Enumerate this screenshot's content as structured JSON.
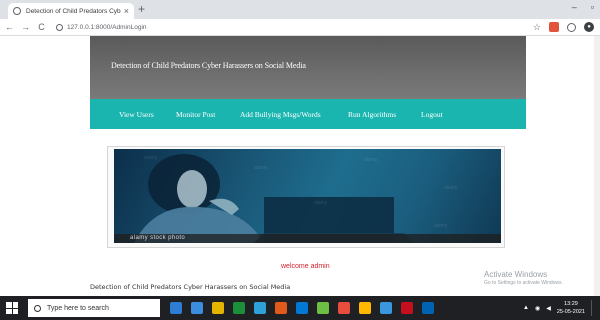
{
  "browser": {
    "tab_title": "Detection of Child Predators Cyb",
    "tab_close": "×",
    "new_tab": "+",
    "minimize": "–",
    "restore": "▫",
    "url": "127.0.0.1:8000/AdminLogin"
  },
  "site": {
    "title": "Detection of Child Predators Cyber Harassers on Social Media",
    "nav": [
      {
        "label": "View Users"
      },
      {
        "label": "Monitor Post"
      },
      {
        "label": "Add Bullying Msgs/Words"
      },
      {
        "label": "Run Algorithms"
      },
      {
        "label": "Logout"
      }
    ],
    "image_watermark": "alamy stock photo",
    "welcome": "welcome admin",
    "footer": "Detection of Child Predators Cyber Harassers on Social Media"
  },
  "windows_overlay": {
    "line1": "Activate Windows",
    "line2": "Go to Settings to activate Windows."
  },
  "taskbar": {
    "search_placeholder": "Type here to search",
    "app_colors": [
      "#2d7dd2",
      "#3c8dde",
      "#e3b400",
      "#1b8f3a",
      "#2fa0d8",
      "#e05a1c",
      "#0078d4",
      "#6cbe45",
      "#e84c3d",
      "#ffb900",
      "#3a96dd",
      "#c50f1f",
      "#0063b1"
    ],
    "time": "13:29",
    "date": "25-05-2021"
  },
  "colors": {
    "nav_bg": "#1bb5b0",
    "header_bg": "#666666",
    "welcome": "#d2222d"
  }
}
